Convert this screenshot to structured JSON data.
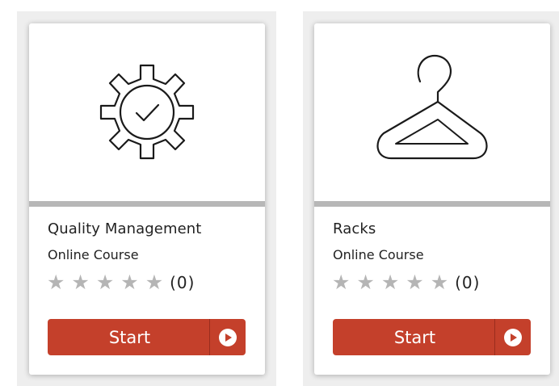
{
  "courses": [
    {
      "icon": "gear-check-icon",
      "title": "Quality Management",
      "type": "Online Course",
      "rating_stars": 5,
      "rating_value": 0,
      "review_count": "(0)",
      "button_label": "Start"
    },
    {
      "icon": "hanger-icon",
      "title": "Racks",
      "type": "Online Course",
      "rating_stars": 5,
      "rating_value": 0,
      "review_count": "(0)",
      "button_label": "Start"
    }
  ],
  "colors": {
    "button": "#c4402b",
    "star_empty": "#b5b5b5",
    "divider": "#b7b7b7"
  }
}
